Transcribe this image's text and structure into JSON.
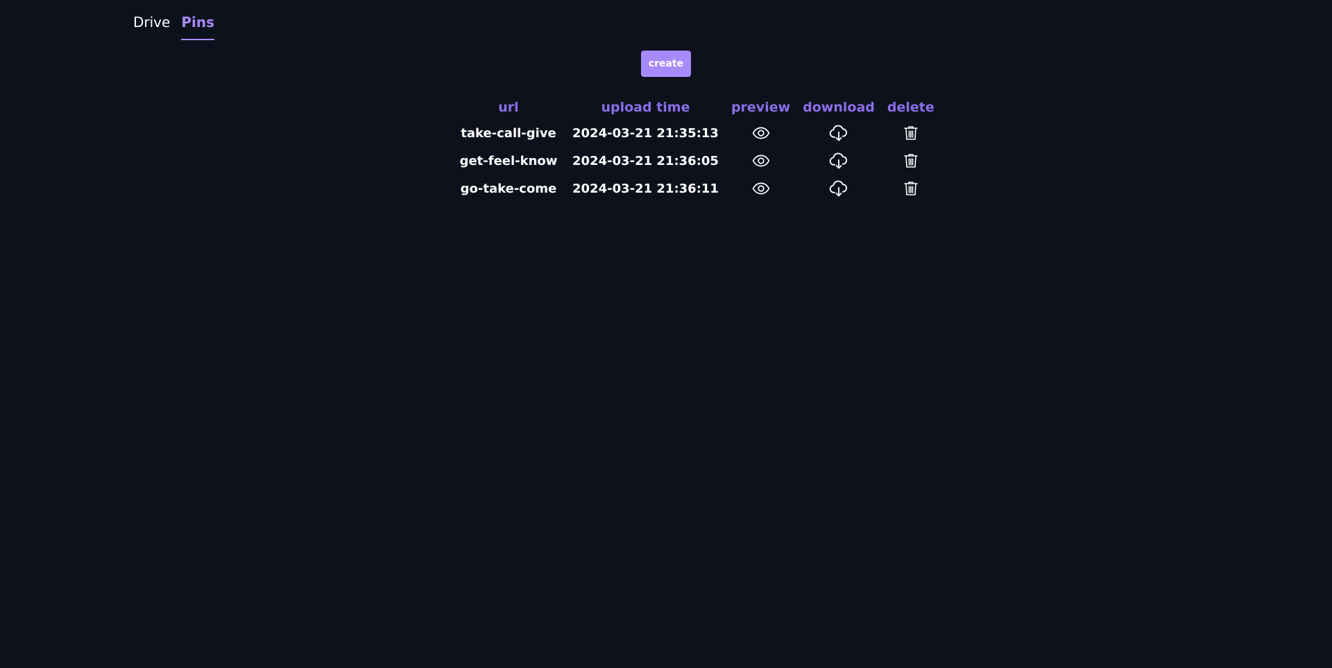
{
  "nav": {
    "tabs": [
      {
        "label": "Drive",
        "active": false
      },
      {
        "label": "Pins",
        "active": true
      }
    ]
  },
  "toolbar": {
    "create_label": "create"
  },
  "table": {
    "headers": {
      "url": "url",
      "upload_time": "upload time",
      "preview": "preview",
      "download": "download",
      "delete": "delete"
    },
    "rows": [
      {
        "url": "take-call-give",
        "upload_time": "2024-03-21 21:35:13"
      },
      {
        "url": "get-feel-know",
        "upload_time": "2024-03-21 21:36:05"
      },
      {
        "url": "go-take-come",
        "upload_time": "2024-03-21 21:36:11"
      }
    ],
    "icons": {
      "preview": "eye-icon",
      "download": "cloud-download-icon",
      "delete": "trash-icon"
    }
  },
  "colors": {
    "background": "#0d111c",
    "accent": "#a78bfa",
    "header_text": "#8b6ee8",
    "text": "#ffffff"
  }
}
